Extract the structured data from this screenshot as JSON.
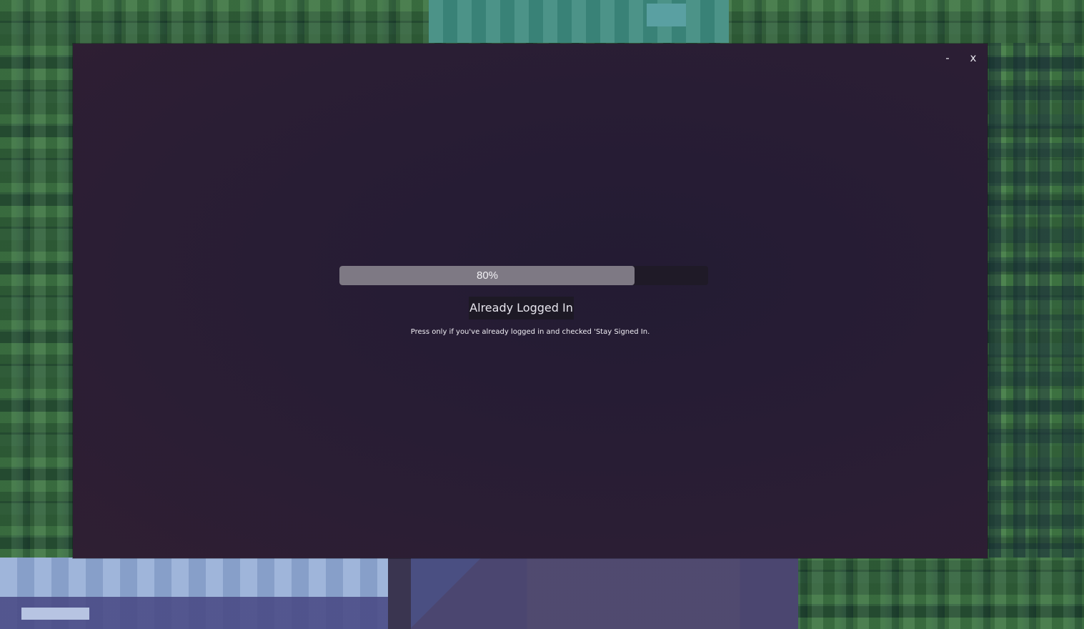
{
  "window": {
    "minimize_label": "-",
    "close_label": "x"
  },
  "progress": {
    "value": 0.8,
    "label": "80%"
  },
  "login": {
    "already_logged_in_label": "Already Logged In",
    "hint": "Press only if you've already logged in and checked 'Stay Signed In."
  }
}
